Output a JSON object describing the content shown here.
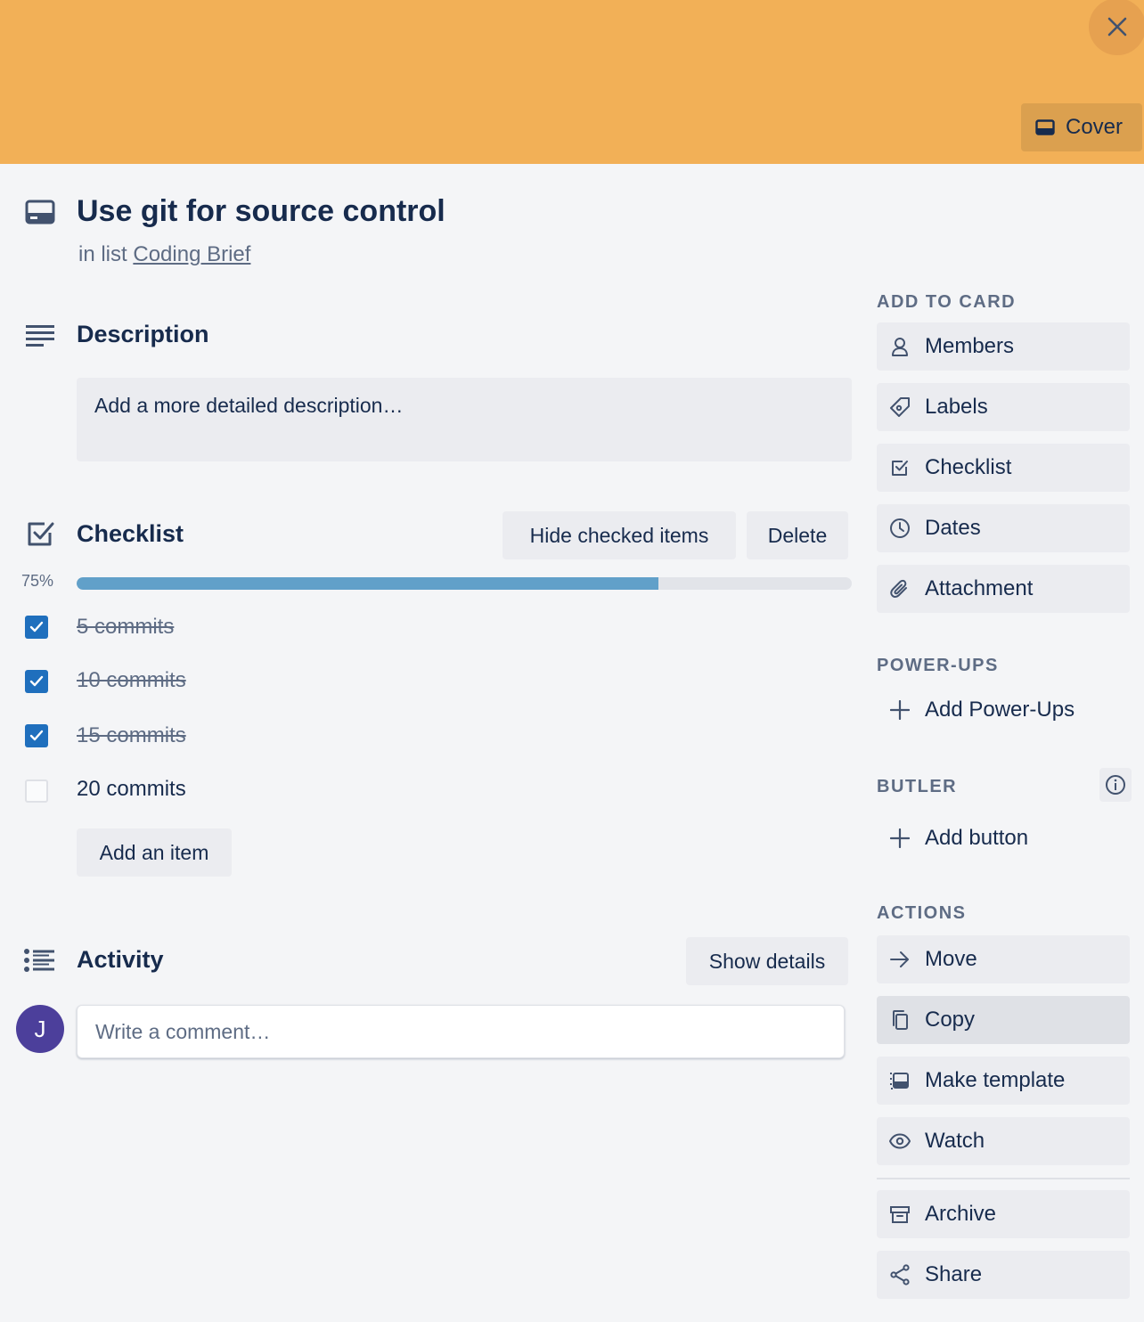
{
  "cover": {
    "color": "#f2b057",
    "cover_button_label": "Cover",
    "close_icon": "close-icon"
  },
  "card": {
    "title": "Use git for source control",
    "in_list_prefix": "in list",
    "list_name": "Coding Brief"
  },
  "description": {
    "heading": "Description",
    "placeholder": "Add a more detailed description…"
  },
  "checklist": {
    "heading": "Checklist",
    "hide_checked_label": "Hide checked items",
    "delete_label": "Delete",
    "progress_label": "75%",
    "progress_fraction": 0.75,
    "progress_color": "#61a0c9",
    "items": [
      {
        "label": "5 commits",
        "checked": true
      },
      {
        "label": "10 commits",
        "checked": true
      },
      {
        "label": "15 commits",
        "checked": true
      },
      {
        "label": "20 commits",
        "checked": false
      }
    ],
    "add_item_label": "Add an item"
  },
  "activity": {
    "heading": "Activity",
    "show_details_label": "Show details",
    "avatar_initial": "J",
    "comment_placeholder": "Write a comment…"
  },
  "sidebar": {
    "add_to_card_heading": "ADD TO CARD",
    "add_to_card": [
      {
        "label": "Members",
        "icon": "person-icon"
      },
      {
        "label": "Labels",
        "icon": "tag-icon"
      },
      {
        "label": "Checklist",
        "icon": "checklist-icon"
      },
      {
        "label": "Dates",
        "icon": "clock-icon"
      },
      {
        "label": "Attachment",
        "icon": "paperclip-icon"
      }
    ],
    "powerups_heading": "POWER-UPS",
    "add_powerups_label": "Add Power-Ups",
    "butler_heading": "BUTLER",
    "add_button_label": "Add button",
    "actions_heading": "ACTIONS",
    "actions": [
      {
        "label": "Move",
        "icon": "arrow-right-icon"
      },
      {
        "label": "Copy",
        "icon": "copy-icon"
      },
      {
        "label": "Make template",
        "icon": "template-icon"
      },
      {
        "label": "Watch",
        "icon": "eye-icon"
      },
      {
        "label": "Archive",
        "icon": "archive-icon"
      },
      {
        "label": "Share",
        "icon": "share-icon"
      }
    ]
  }
}
